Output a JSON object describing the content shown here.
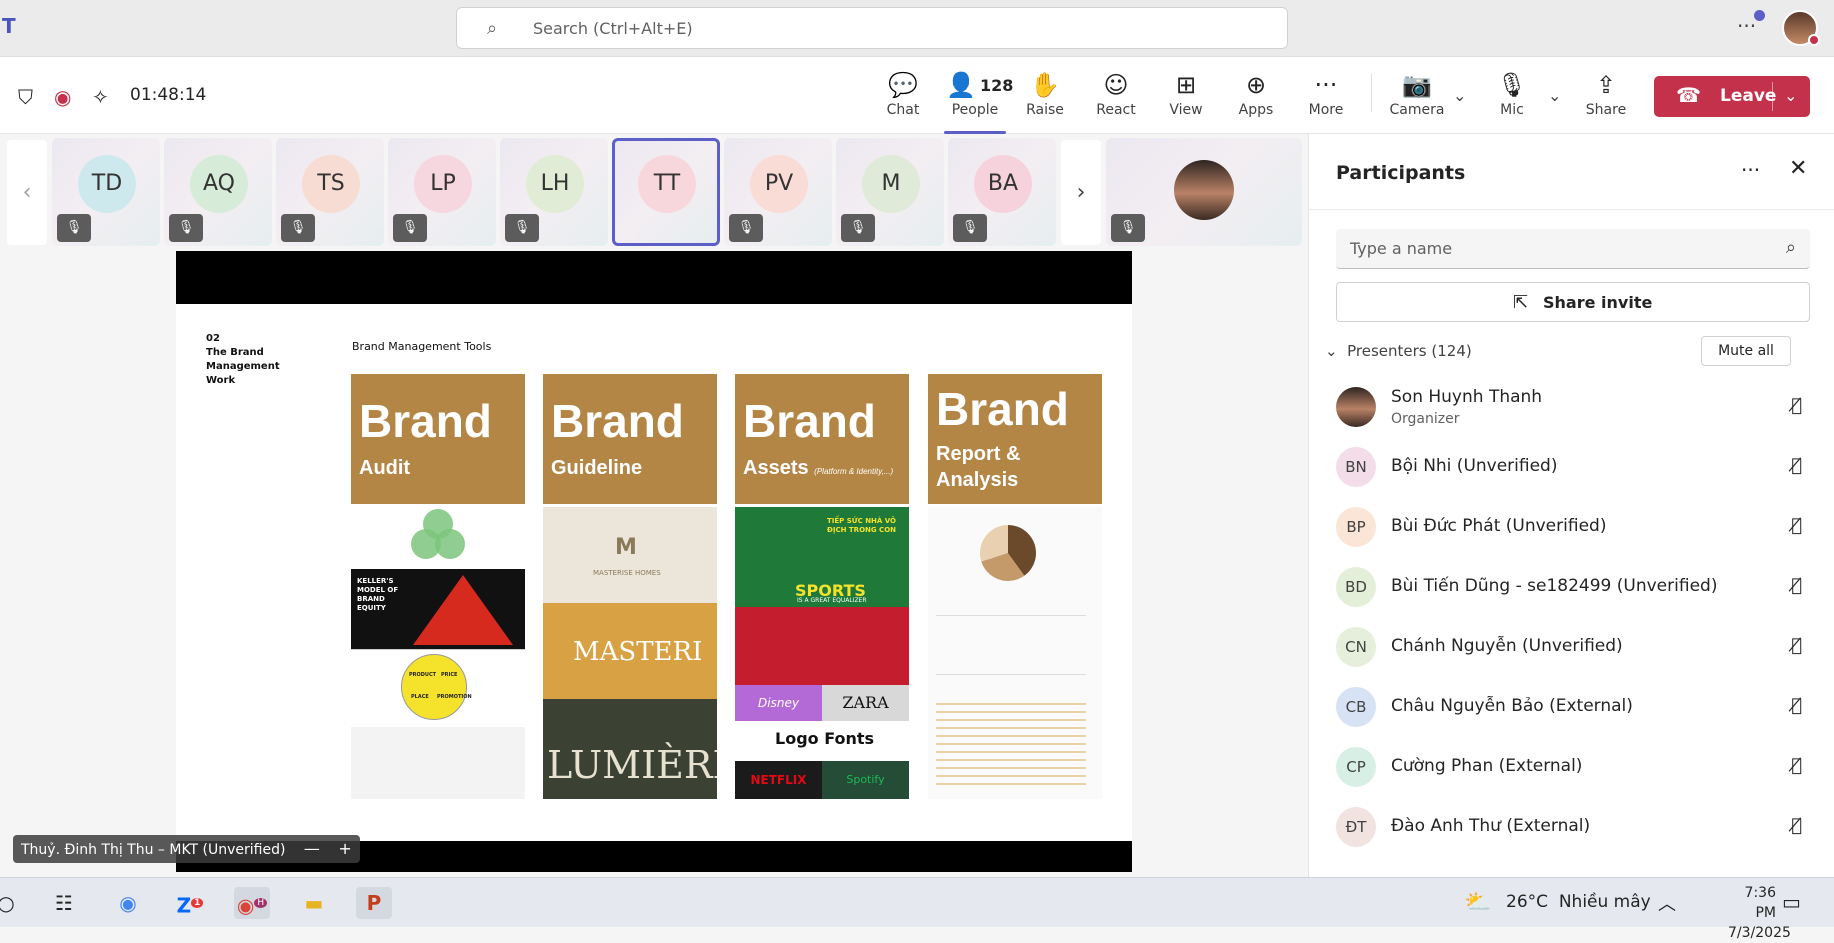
{
  "top": {
    "search_placeholder": "Search (Ctrl+Alt+E)",
    "more": "···"
  },
  "meeting": {
    "timer": "01:48:14",
    "tools": {
      "chat": "Chat",
      "people": "People",
      "people_count": "128",
      "raise": "Raise",
      "react": "React",
      "view": "View",
      "apps": "Apps",
      "more": "More",
      "camera": "Camera",
      "mic": "Mic",
      "share": "Share"
    },
    "leave": "Leave"
  },
  "strip": {
    "tiles": [
      {
        "initials": "TD",
        "color": "#cde9ee"
      },
      {
        "initials": "AQ",
        "color": "#d6ecd8"
      },
      {
        "initials": "TS",
        "color": "#f7dcd4"
      },
      {
        "initials": "LP",
        "color": "#f6d6df"
      },
      {
        "initials": "LH",
        "color": "#e0ecd5"
      },
      {
        "initials": "TT",
        "color": "#f7d7dc"
      },
      {
        "initials": "PV",
        "color": "#f9dcd6"
      },
      {
        "initials": "M",
        "color": "#e0ead8"
      },
      {
        "initials": "BA",
        "color": "#f6d3dc"
      }
    ]
  },
  "slide": {
    "section": [
      "02",
      "The Brand",
      "Management",
      "Work"
    ],
    "title": "Brand Management Tools",
    "cols": [
      {
        "big": "Brand",
        "sub": "Audit",
        "small": ""
      },
      {
        "big": "Brand",
        "sub": "Guideline",
        "small": ""
      },
      {
        "big": "Brand",
        "sub": "Assets",
        "small": "(Platform & Identity,...)"
      },
      {
        "big": "Brand",
        "sub": "Report &",
        "sub2": "Analysis",
        "small": ""
      }
    ],
    "thumbs": {
      "keller": "KELLER'S MODEL OF BRAND EQUITY",
      "pies": [
        "PRODUCT",
        "PRICE",
        "PLACE",
        "PROMOTION"
      ],
      "masterise": "MASTERISE HOMES",
      "masteri": "MASTERI",
      "lumiere": "LUMIÈRE",
      "milo_head": "TIẾP SỨC NHÀ VÔ ĐỊCH TRONG CON",
      "milo_sports": "SPORTS",
      "milo_tag": "IS A GREAT EQUALIZER",
      "disney": "Disney",
      "zara": "ZARA",
      "logo_fonts": "Logo Fonts",
      "netflix": "NETFLIX",
      "spotify": "Spotify"
    },
    "speaker": "Thuỷ. Đinh Thị Thu – MKT (Unverified)"
  },
  "panel": {
    "title": "Participants",
    "search_placeholder": "Type a name",
    "share_invite": "Share invite",
    "presenters": "Presenters (124)",
    "mute_all": "Mute all",
    "people": [
      {
        "initials": "",
        "name": "Son Huynh Thanh",
        "role": "Organizer",
        "photo": true,
        "color": "#ccc"
      },
      {
        "initials": "BN",
        "name": "Bội Nhi (Unverified)",
        "role": "",
        "photo": false,
        "color": "#f3dde8"
      },
      {
        "initials": "BP",
        "name": "Bùi Đức Phát (Unverified)",
        "role": "",
        "photo": false,
        "color": "#fbe5d6"
      },
      {
        "initials": "BD",
        "name": "Bùi Tiến Dũng - se182499 (Unverified)",
        "role": "",
        "photo": false,
        "color": "#e3efd9"
      },
      {
        "initials": "CN",
        "name": "Chánh Nguyễn (Unverified)",
        "role": "",
        "photo": false,
        "color": "#e6efdb"
      },
      {
        "initials": "CB",
        "name": "Châu Nguyễn Bảo (External)",
        "role": "",
        "photo": false,
        "color": "#d7e3f5"
      },
      {
        "initials": "CP",
        "name": "Cường Phan (External)",
        "role": "",
        "photo": false,
        "color": "#d8efe6"
      },
      {
        "initials": "ĐT",
        "name": "Đào Anh Thư (External)",
        "role": "",
        "photo": false,
        "color": "#f0e3e0"
      }
    ]
  },
  "taskbar": {
    "temp": "26°C",
    "weather": "Nhiều mây",
    "time": "7:36 PM",
    "date": "7/3/2025",
    "zalo_badge": "1",
    "chrome_badge": "H"
  },
  "colors": {
    "accent": "#5b5fc7",
    "leave": "#c4314b",
    "brand_gold": "#b38646"
  }
}
